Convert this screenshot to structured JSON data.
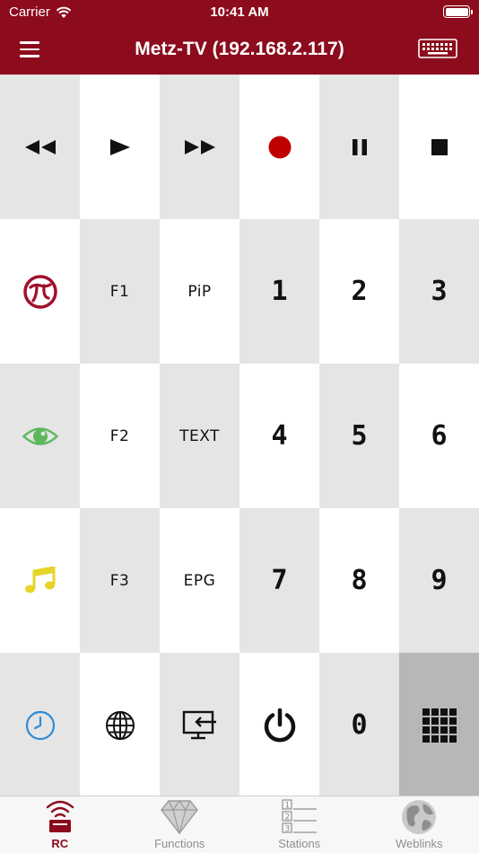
{
  "status": {
    "carrier": "Carrier",
    "time": "10:41 AM"
  },
  "nav": {
    "title": "Metz-TV (192.168.2.117)"
  },
  "keys": {
    "f1": "F1",
    "pip": "PiP",
    "f2": "F2",
    "text": "TEXT",
    "f3": "F3",
    "epg": "EPG",
    "n1": "1",
    "n2": "2",
    "n3": "3",
    "n4": "4",
    "n5": "5",
    "n6": "6",
    "n7": "7",
    "n8": "8",
    "n9": "9",
    "n0": "0"
  },
  "icons": {
    "rewind": "rewind-icon",
    "play": "play-icon",
    "forward": "fast-forward-icon",
    "record": "record-icon",
    "pause": "pause-icon",
    "stop": "stop-icon",
    "metz_logo": "metz-logo-icon",
    "eye": "eye-icon",
    "music": "music-note-icon",
    "clock": "clock-icon",
    "globe": "globe-icon",
    "source": "source-input-icon",
    "power": "power-icon",
    "numpad": "numpad-icon"
  },
  "colors": {
    "brand": "#8c0b1c",
    "record": "#c00000",
    "eye": "#5cb85c",
    "music": "#e6d42a",
    "clock": "#2e8bd6",
    "cell_gray": "#e5e5e5",
    "cell_dark": "#b7b7b7"
  },
  "tabs": {
    "rc": "RC",
    "functions": "Functions",
    "stations": "Stations",
    "weblinks": "Weblinks"
  }
}
